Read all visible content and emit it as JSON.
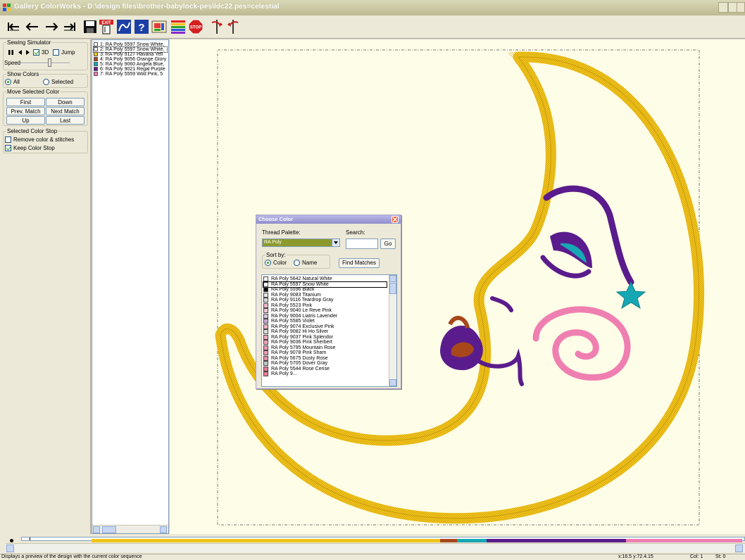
{
  "window": {
    "title": "Gallery ColorWorks - D:\\design files\\brother-babylock-pes\\ldc22.pes=celestial"
  },
  "left_panel": {
    "simulator": {
      "legend": "Sewing Simulator",
      "check_3d": "3D",
      "check_3d_on": true,
      "check_jump": "Jump",
      "check_jump_on": false,
      "speed_label": "Speed"
    },
    "show_colors": {
      "legend": "Show Colors",
      "all": "All",
      "selected": "Selected",
      "selected_value": "All"
    },
    "move_color": {
      "legend": "Move Selected Color",
      "first": "First",
      "down": "Down",
      "prev": "Prev. Match",
      "next": "Next Match",
      "up": "Up",
      "last": "Last"
    },
    "color_stop": {
      "legend": "Selected Color Stop",
      "remove": "Remove color & stitches",
      "remove_on": false,
      "keep": "Keep Color Stop",
      "keep_on": true
    }
  },
  "color_list": {
    "items": [
      {
        "label": "1: RA Poly 5597 Snow White,",
        "color": "#ffffff"
      },
      {
        "label": "2: RA Poly 5597 Snow White,",
        "color": "#ffffff"
      },
      {
        "label": "3: RA Poly 9127 Havana Yell",
        "color": "#f2c41b"
      },
      {
        "label": "4: RA Poly 9056 Orange Glory",
        "color": "#a8471c"
      },
      {
        "label": "5: RA Poly 9060 Angela Blue,",
        "color": "#16a7b4"
      },
      {
        "label": "6: RA Poly 9021 Regal Purple",
        "color": "#5a1c8c"
      },
      {
        "label": "7: RA Poly 5559 Wild Pink, 5",
        "color": "#ef7fb1"
      }
    ]
  },
  "dialog": {
    "title": "Choose Color",
    "palette_label": "Thread Palette:",
    "palette_value": "RA Poly",
    "search_label": "Search:",
    "search_value": "",
    "go": "Go",
    "sort_legend": "Sort by:",
    "sort_color": "Color",
    "sort_name": "Name",
    "sort_selected": "Color",
    "find_matches": "Find Matches",
    "threads": [
      {
        "label": "RA Poly 5642 Natural White",
        "color": "#ffffff"
      },
      {
        "label": "RA Poly 5597 Snow White",
        "color": "#ffffff"
      },
      {
        "label": "RA Poly 5596 Black",
        "color": "#000000"
      },
      {
        "label": "RA Poly 9083 Titanium",
        "color": "#e8e8e6"
      },
      {
        "label": "RA Poly 9116 Teardrop Gray",
        "color": "#d6d8dc"
      },
      {
        "label": "RA Poly 5523 Pink",
        "color": "#f5b7c8"
      },
      {
        "label": "RA Poly 9040 Le Reve Pink",
        "color": "#f3c5cf"
      },
      {
        "label": "RA Poly 9004 Liatris Lavender",
        "color": "#d9c4e3"
      },
      {
        "label": "RA Poly 5585 Violet",
        "color": "#c9a9d6"
      },
      {
        "label": "RA Poly 9074 Exclusive Pink",
        "color": "#f2b6c4"
      },
      {
        "label": "RA Poly 9082 Hi Ho Silver",
        "color": "#dcdcdc"
      },
      {
        "label": "RA Poly 9037 Pink Splendor",
        "color": "#f4a9bd"
      },
      {
        "label": "RA Poly 9036 Pink Sherbert",
        "color": "#f5a3b5"
      },
      {
        "label": "RA Poly 5795 Mountain Rose",
        "color": "#ee97ad"
      },
      {
        "label": "RA Poly 9078 Pink Sham",
        "color": "#f29cb3"
      },
      {
        "label": "RA Poly 5675 Dusty Rose",
        "color": "#e48fa3"
      },
      {
        "label": "RA Poly 5705 Dover Gray",
        "color": "#c6c6c6"
      },
      {
        "label": "RA Poly 5544 Rose Cerise",
        "color": "#e9778f"
      },
      {
        "label": "RA Poly 9...",
        "color": "#f07a98"
      }
    ]
  },
  "sequence_bar": {
    "segments": [
      {
        "color": "#f2c41b",
        "fraction": 0.536
      },
      {
        "color": "#a8471c",
        "fraction": 0.026
      },
      {
        "color": "#16a7b4",
        "fraction": 0.045
      },
      {
        "color": "#5a1c8c",
        "fraction": 0.214
      },
      {
        "color": "#ef7fb1",
        "fraction": 0.179
      }
    ]
  },
  "status": {
    "message": "Displays a preview of the design with the current color sequence",
    "coords": "x:16.5 y:72.4.15",
    "col": "Col: 1",
    "st": "St: 0"
  },
  "colors": {
    "moon": "#f2c41b",
    "purple": "#5a1c8c",
    "teal": "#16a7b4",
    "pink": "#ef7fb1",
    "orange": "#a8471c",
    "canvas": "#fefde7"
  }
}
